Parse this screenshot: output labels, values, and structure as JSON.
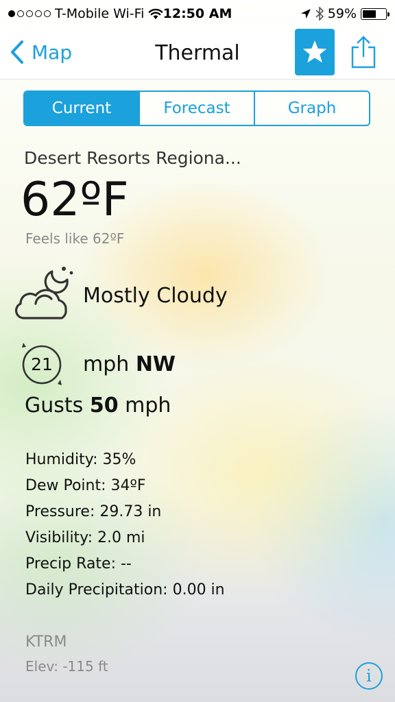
{
  "status_bar": {
    "carrier": "T-Mobile Wi-Fi",
    "time": "12:50 AM",
    "battery": "59%",
    "battery_level": 0.59,
    "signal_bars_filled": 1,
    "signal_bars_total": 5
  },
  "nav": {
    "back_label": "Map",
    "title": "Thermal"
  },
  "tabs": [
    {
      "label": "Current",
      "active": true
    },
    {
      "label": "Forecast",
      "active": false
    },
    {
      "label": "Graph",
      "active": false
    }
  ],
  "weather": {
    "station_name": "Desert Resorts Regiona...",
    "temperature": "62ºF",
    "feels_like": "Feels like 62ºF",
    "condition": "Mostly Cloudy",
    "condition_icon": "partly-cloudy-night-icon",
    "wind_speed": "21",
    "wind_unit": "mph",
    "wind_direction": "NW",
    "gusts_label": "Gusts",
    "gusts_value": "50",
    "gusts_unit": "mph"
  },
  "details": [
    "Humidity: 35%",
    "Dew Point: 34ºF",
    "Pressure: 29.73 in",
    "Visibility: 2.0 mi",
    "Precip Rate: --",
    "Daily Precipitation: 0.00 in"
  ],
  "station": {
    "id": "KTRM",
    "elevation": "Elev: -115 ft"
  },
  "colors": {
    "accent": "#1ba1dc",
    "muted_text": "#8a8a8a"
  }
}
